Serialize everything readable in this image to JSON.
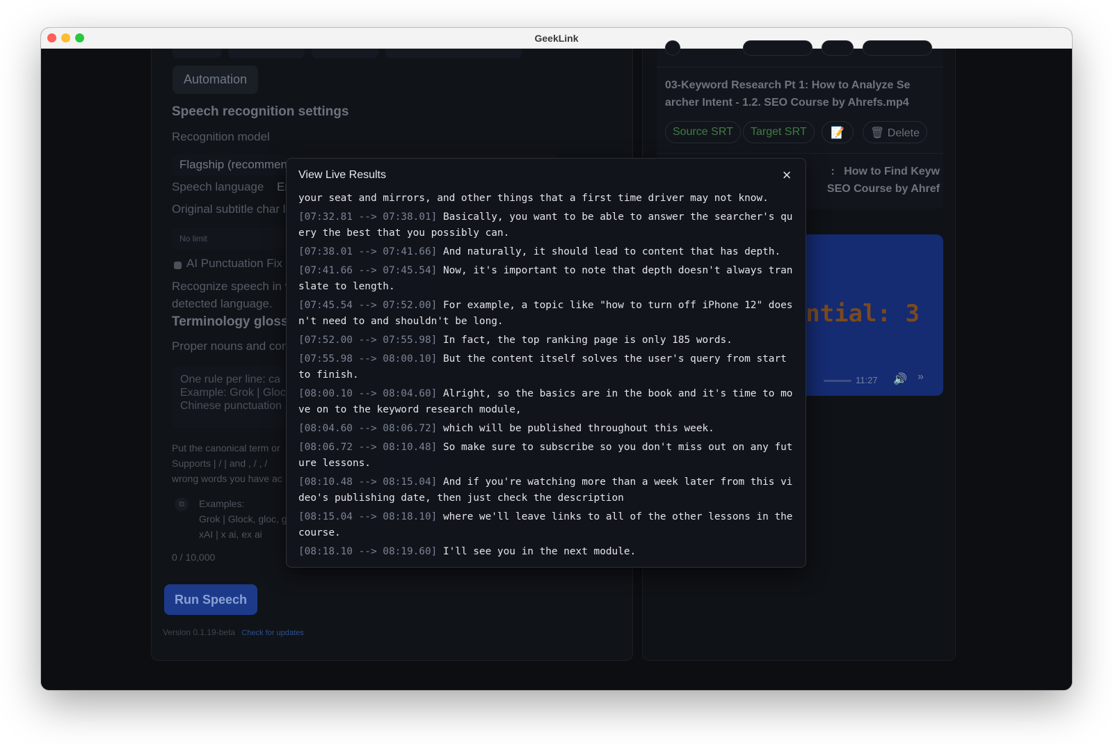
{
  "window": {
    "title": "GeekLink"
  },
  "left": {
    "automation": "Automation",
    "speech_settings_title": "Speech recognition settings",
    "recognition_model_label": "Recognition model",
    "recognition_model_value": "Flagship (recommen",
    "speech_language_label": "Speech language",
    "speech_language_value": "Er",
    "original_char_label": "Original subtitle char l",
    "no_limit": "No limit",
    "ai_punct": "AI Punctuation Fix (",
    "recognize_desc_1": "Recognize speech in v",
    "recognize_desc_2": "detected language.",
    "terminology_title": "Terminology gloss",
    "proper_nouns": "Proper nouns and com",
    "textarea_lines": [
      "One rule per line: ca",
      "Example: Grok | Gloc",
      "Chinese punctuation"
    ],
    "help_1": "Put the canonical term or",
    "help_2": "Supports | /  |  and , / ,   /",
    "help_3": "wrong words you have ac",
    "examples_label": "Examples:",
    "example_1": "Grok | Glock, gloc, g",
    "example_2": "xAI | x ai,  ex ai",
    "counter": "0 / 10,000",
    "run_button": "Run Speech",
    "version": "Version 0.1.19-beta",
    "check_updates": "Check for updates"
  },
  "right": {
    "file_title": "03-Keyword Research Pt 1:  How to Analyze Searcher Intent - 1.2. SEO Course by Ahrefs.mp4",
    "file_title_line1": "03-Keyword Research Pt 1:  How to Analyze Se",
    "file_title_line2": "archer Intent - 1.2. SEO Course by Ahrefs.mp4",
    "source_srt": "Source SRT",
    "target_srt": "Target SRT",
    "edit_icon": "📝",
    "delete": "Delete",
    "delete_icon": "🗑",
    "next_title_line1": "How to Find Keyw",
    "next_title_line2": "SEO Course by Ahref",
    "next_title_colon": ":",
    "video_overlay": "ential: 3",
    "video_time": "11:27",
    "volume_icon": "🔊",
    "more_icon": "»"
  },
  "modal": {
    "title": "View Live Results",
    "close": "×",
    "lines": [
      {
        "ts": "",
        "text": "your seat and mirrors, and other things that a first time driver may not know."
      },
      {
        "ts": "[07:32.81 --> 07:38.01]",
        "text": "Basically, you want to be able to answer the searcher's query the best that you possibly can."
      },
      {
        "ts": "[07:38.01 --> 07:41.66]",
        "text": "And naturally, it should lead to content that has depth."
      },
      {
        "ts": "[07:41.66 --> 07:45.54]",
        "text": "Now, it's important to note that depth doesn't always translate to length."
      },
      {
        "ts": "[07:45.54 --> 07:52.00]",
        "text": "For example, a topic like \"how to turn off iPhone 12\" doesn't need to and shouldn't be long."
      },
      {
        "ts": "[07:52.00 --> 07:55.98]",
        "text": "In fact, the top ranking page is only 185 words."
      },
      {
        "ts": "[07:55.98 --> 08:00.10]",
        "text": "But the content itself solves the user's query from start to finish."
      },
      {
        "ts": "[08:00.10 --> 08:04.60]",
        "text": "Alright, so the basics are in the book and it's time to move on to the keyword research module,"
      },
      {
        "ts": "[08:04.60 --> 08:06.72]",
        "text": "which will be published throughout this week."
      },
      {
        "ts": "[08:06.72 --> 08:10.48]",
        "text": "So make sure to subscribe so you don't miss out on any future lessons."
      },
      {
        "ts": "[08:10.48 --> 08:15.04]",
        "text": "And if you're watching more than a week later from this video's publishing date, then just check the description"
      },
      {
        "ts": "[08:15.04 --> 08:18.10]",
        "text": "where we'll leave links to all of the other lessons in the course."
      },
      {
        "ts": "[08:18.10 --> 08:19.60]",
        "text": "I'll see you in the next module."
      }
    ]
  },
  "colors": {
    "accent": "#1d3a8a",
    "srt_green": "#3f7c43",
    "video_bg": "#152b72"
  }
}
